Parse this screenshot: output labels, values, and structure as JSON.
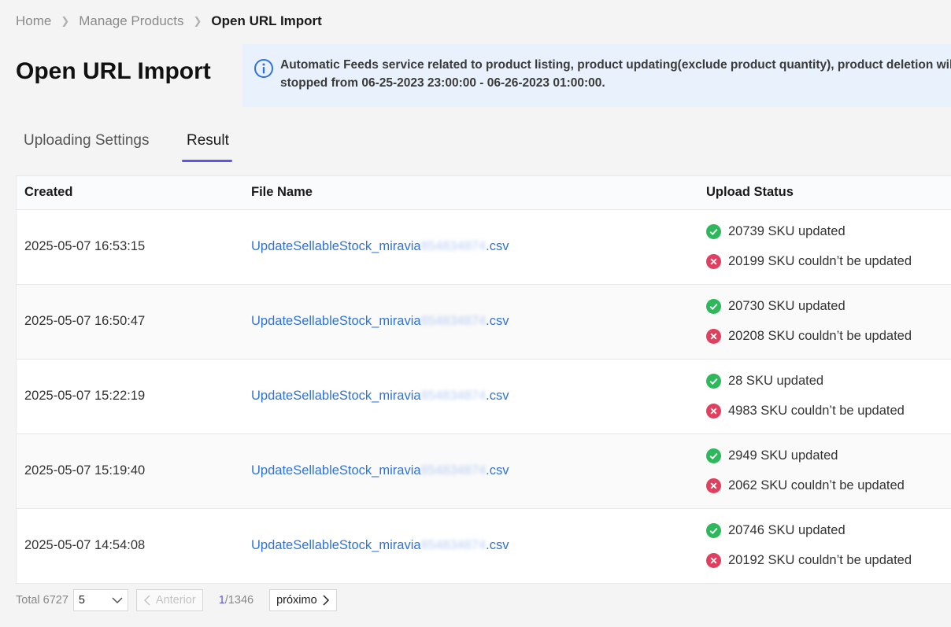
{
  "breadcrumb": {
    "items": [
      "Home",
      "Manage Products"
    ],
    "current": "Open URL Import"
  },
  "page": {
    "title": "Open URL Import"
  },
  "notice": {
    "line1": "Automatic Feeds service related to product listing, product updating(exclude product quantity), product deletion will be",
    "line2": "stopped from 06-25-2023 23:00:00 - 06-26-2023 01:00:00."
  },
  "tabs": [
    {
      "label": "Uploading Settings",
      "active": false
    },
    {
      "label": "Result",
      "active": true
    }
  ],
  "table": {
    "columns": [
      "Created",
      "File Name",
      "Upload Status"
    ],
    "rows": [
      {
        "created": "2025-05-07 16:53:15",
        "file_prefix": "UpdateSellableStock_miravia",
        "file_blurred": "854834874",
        "file_ext": ".csv",
        "updated": "20739 SKU updated",
        "failed": "20199 SKU couldn’t be updated"
      },
      {
        "created": "2025-05-07 16:50:47",
        "file_prefix": "UpdateSellableStock_miravia",
        "file_blurred": "854834874",
        "file_ext": ".csv",
        "updated": "20730 SKU updated",
        "failed": "20208 SKU couldn’t be updated"
      },
      {
        "created": "2025-05-07 15:22:19",
        "file_prefix": "UpdateSellableStock_miravia",
        "file_blurred": "854834874",
        "file_ext": ".csv",
        "updated": "28 SKU updated",
        "failed": "4983 SKU couldn’t be updated"
      },
      {
        "created": "2025-05-07 15:19:40",
        "file_prefix": "UpdateSellableStock_miravia",
        "file_blurred": "854834874",
        "file_ext": ".csv",
        "updated": "2949 SKU updated",
        "failed": "2062 SKU couldn’t be updated"
      },
      {
        "created": "2025-05-07 14:54:08",
        "file_prefix": "UpdateSellableStock_miravia",
        "file_blurred": "854834874",
        "file_ext": ".csv",
        "updated": "20746 SKU updated",
        "failed": "20192 SKU couldn’t be updated"
      }
    ]
  },
  "pagination": {
    "total": "Total 6727",
    "page_size": "5",
    "prev_label": "Anterior",
    "current_page": "1",
    "total_pages": "/1346",
    "next_label": "próximo"
  },
  "colors": {
    "accent": "#5b57e0",
    "link": "#2f73d8",
    "success": "#2eb85c",
    "error": "#e0405e",
    "info": "#2f73d8"
  },
  "icons": {
    "notice": "info-icon",
    "success": "check-circle-icon",
    "error": "x-circle-icon"
  }
}
